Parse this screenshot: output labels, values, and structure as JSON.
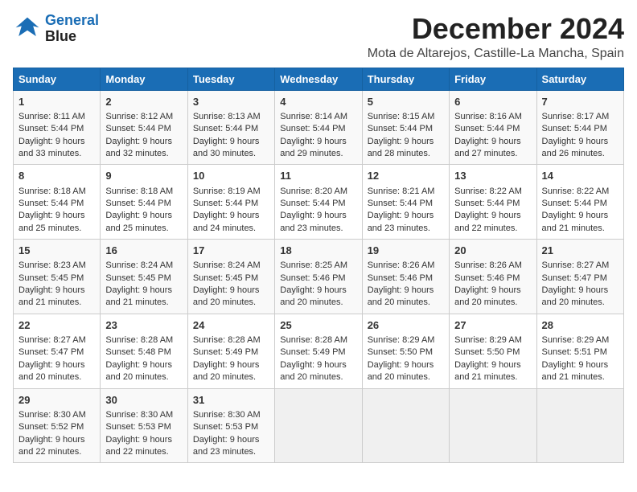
{
  "logo": {
    "line1": "General",
    "line2": "Blue"
  },
  "title": "December 2024",
  "location": "Mota de Altarejos, Castille-La Mancha, Spain",
  "days_of_week": [
    "Sunday",
    "Monday",
    "Tuesday",
    "Wednesday",
    "Thursday",
    "Friday",
    "Saturday"
  ],
  "weeks": [
    [
      {
        "day": 1,
        "sunrise": "8:11 AM",
        "sunset": "5:44 PM",
        "daylight": "9 hours and 33 minutes."
      },
      {
        "day": 2,
        "sunrise": "8:12 AM",
        "sunset": "5:44 PM",
        "daylight": "9 hours and 32 minutes."
      },
      {
        "day": 3,
        "sunrise": "8:13 AM",
        "sunset": "5:44 PM",
        "daylight": "9 hours and 30 minutes."
      },
      {
        "day": 4,
        "sunrise": "8:14 AM",
        "sunset": "5:44 PM",
        "daylight": "9 hours and 29 minutes."
      },
      {
        "day": 5,
        "sunrise": "8:15 AM",
        "sunset": "5:44 PM",
        "daylight": "9 hours and 28 minutes."
      },
      {
        "day": 6,
        "sunrise": "8:16 AM",
        "sunset": "5:44 PM",
        "daylight": "9 hours and 27 minutes."
      },
      {
        "day": 7,
        "sunrise": "8:17 AM",
        "sunset": "5:44 PM",
        "daylight": "9 hours and 26 minutes."
      }
    ],
    [
      {
        "day": 8,
        "sunrise": "8:18 AM",
        "sunset": "5:44 PM",
        "daylight": "9 hours and 25 minutes."
      },
      {
        "day": 9,
        "sunrise": "8:18 AM",
        "sunset": "5:44 PM",
        "daylight": "9 hours and 25 minutes."
      },
      {
        "day": 10,
        "sunrise": "8:19 AM",
        "sunset": "5:44 PM",
        "daylight": "9 hours and 24 minutes."
      },
      {
        "day": 11,
        "sunrise": "8:20 AM",
        "sunset": "5:44 PM",
        "daylight": "9 hours and 23 minutes."
      },
      {
        "day": 12,
        "sunrise": "8:21 AM",
        "sunset": "5:44 PM",
        "daylight": "9 hours and 23 minutes."
      },
      {
        "day": 13,
        "sunrise": "8:22 AM",
        "sunset": "5:44 PM",
        "daylight": "9 hours and 22 minutes."
      },
      {
        "day": 14,
        "sunrise": "8:22 AM",
        "sunset": "5:44 PM",
        "daylight": "9 hours and 21 minutes."
      }
    ],
    [
      {
        "day": 15,
        "sunrise": "8:23 AM",
        "sunset": "5:45 PM",
        "daylight": "9 hours and 21 minutes."
      },
      {
        "day": 16,
        "sunrise": "8:24 AM",
        "sunset": "5:45 PM",
        "daylight": "9 hours and 21 minutes."
      },
      {
        "day": 17,
        "sunrise": "8:24 AM",
        "sunset": "5:45 PM",
        "daylight": "9 hours and 20 minutes."
      },
      {
        "day": 18,
        "sunrise": "8:25 AM",
        "sunset": "5:46 PM",
        "daylight": "9 hours and 20 minutes."
      },
      {
        "day": 19,
        "sunrise": "8:26 AM",
        "sunset": "5:46 PM",
        "daylight": "9 hours and 20 minutes."
      },
      {
        "day": 20,
        "sunrise": "8:26 AM",
        "sunset": "5:46 PM",
        "daylight": "9 hours and 20 minutes."
      },
      {
        "day": 21,
        "sunrise": "8:27 AM",
        "sunset": "5:47 PM",
        "daylight": "9 hours and 20 minutes."
      }
    ],
    [
      {
        "day": 22,
        "sunrise": "8:27 AM",
        "sunset": "5:47 PM",
        "daylight": "9 hours and 20 minutes."
      },
      {
        "day": 23,
        "sunrise": "8:28 AM",
        "sunset": "5:48 PM",
        "daylight": "9 hours and 20 minutes."
      },
      {
        "day": 24,
        "sunrise": "8:28 AM",
        "sunset": "5:49 PM",
        "daylight": "9 hours and 20 minutes."
      },
      {
        "day": 25,
        "sunrise": "8:28 AM",
        "sunset": "5:49 PM",
        "daylight": "9 hours and 20 minutes."
      },
      {
        "day": 26,
        "sunrise": "8:29 AM",
        "sunset": "5:50 PM",
        "daylight": "9 hours and 20 minutes."
      },
      {
        "day": 27,
        "sunrise": "8:29 AM",
        "sunset": "5:50 PM",
        "daylight": "9 hours and 21 minutes."
      },
      {
        "day": 28,
        "sunrise": "8:29 AM",
        "sunset": "5:51 PM",
        "daylight": "9 hours and 21 minutes."
      }
    ],
    [
      {
        "day": 29,
        "sunrise": "8:30 AM",
        "sunset": "5:52 PM",
        "daylight": "9 hours and 22 minutes."
      },
      {
        "day": 30,
        "sunrise": "8:30 AM",
        "sunset": "5:53 PM",
        "daylight": "9 hours and 22 minutes."
      },
      {
        "day": 31,
        "sunrise": "8:30 AM",
        "sunset": "5:53 PM",
        "daylight": "9 hours and 23 minutes."
      },
      null,
      null,
      null,
      null
    ]
  ]
}
